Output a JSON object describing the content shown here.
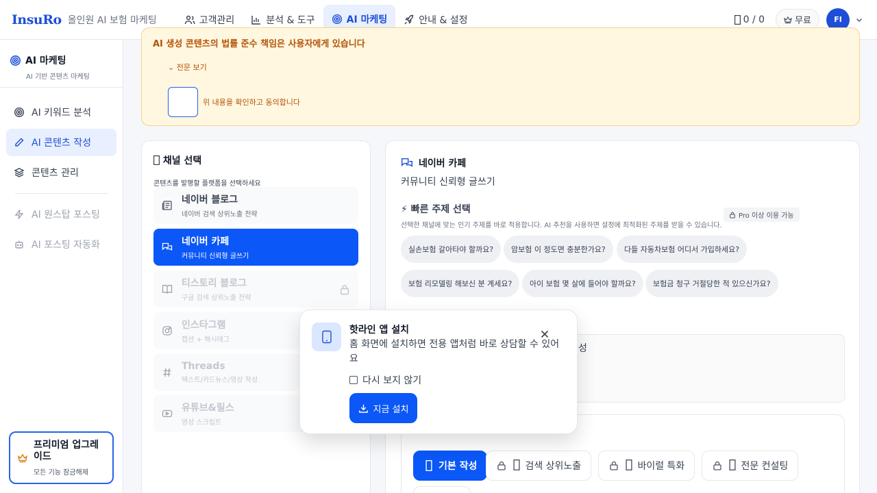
{
  "header": {
    "logo": "InsuRo",
    "tagline": "올인원 AI 보험 마케팅",
    "nav": [
      {
        "label": "고객관리"
      },
      {
        "label": "분석 & 도구"
      },
      {
        "label": "AI 마케팅"
      },
      {
        "label": "안내 & 설정"
      }
    ],
    "credit": "0 / 0",
    "plan": "무료",
    "avatar": "FI"
  },
  "sidebar": {
    "title": "AI 마케팅",
    "subtitle": "AI 기반 콘텐츠 마케팅",
    "items": [
      {
        "label": "AI 키워드 분석"
      },
      {
        "label": "AI 콘텐츠 작성"
      },
      {
        "label": "콘텐츠 관리"
      }
    ],
    "disabled_items": [
      {
        "label": "AI 원스탑 포스팅"
      },
      {
        "label": "AI 포스팅 자동화"
      }
    ],
    "premium": {
      "title": "프리미엄 업그레이드",
      "subtitle": "모든 기능 잠금해제"
    }
  },
  "notice": {
    "text": "AI 생성 콘텐츠의 법률 준수 책임은 사용자에게 있습니다",
    "more": "전문 보기",
    "agree": "위 내용을 확인하고 동의합니다"
  },
  "channels": {
    "title": "채널 선택",
    "subtitle": "콘텐츠를 발행할 플랫폼을 선택하세요",
    "items": [
      {
        "name": "네이버 블로그",
        "desc": "네이버 검색 상위노출 전략"
      },
      {
        "name": "네이버 카페",
        "desc": "커뮤니티 신뢰형 글쓰기"
      },
      {
        "name": "티스토리 블로그",
        "desc": "구글 검색 상위노출 전략"
      },
      {
        "name": "인스타그램",
        "desc": "캡션 + 해시태그"
      },
      {
        "name": "Threads",
        "desc": "텍스트/카드뉴스/영상 작성"
      },
      {
        "name": "유튜브&릴스",
        "desc": "영상 스크립트"
      }
    ]
  },
  "main": {
    "title": "네이버 카페",
    "subtitle": "커뮤니티 신뢰형 글쓰기",
    "quick_title": "⚡ 빠른 주제 선택",
    "quick_sub": "선택한 채널에 맞는 인기 주제를 바로 적용합니다. AI 추천을 사용하면 설정에 최적화된 주제를 받을 수 있습니다.",
    "pro_badge": "Pro 이상 이용 가능",
    "topics": [
      "실손보험 갈아타야 할까요?",
      "암보험 이 정도면 충분한가요?",
      "다들 자동차보험 어디서 가입하세요?",
      "보험 리모델링 해보신 분 계세요?",
      "아이 보험 몇 살에 들어야 할까요?",
      "보험금 청구 거절당한 적 있으신가요?"
    ],
    "input_fragment": "성",
    "styles": [
      {
        "label": "기본 작성"
      },
      {
        "label": "검색 상위노출"
      },
      {
        "label": "바이럴 특화"
      },
      {
        "label": "전문 컨설팅"
      }
    ]
  },
  "popup": {
    "title": "핫라인 앱 설치",
    "desc": "홈 화면에 설치하면 전용 앱처럼 바로 상담할 수 있어요",
    "checkbox": "다시 보지 않기",
    "install": "지금 설치"
  },
  "colors": {
    "primary": "#0b57f7",
    "accent_bg": "#e8efff",
    "notice_bg": "#fff7df",
    "notice_text": "#b45309"
  }
}
